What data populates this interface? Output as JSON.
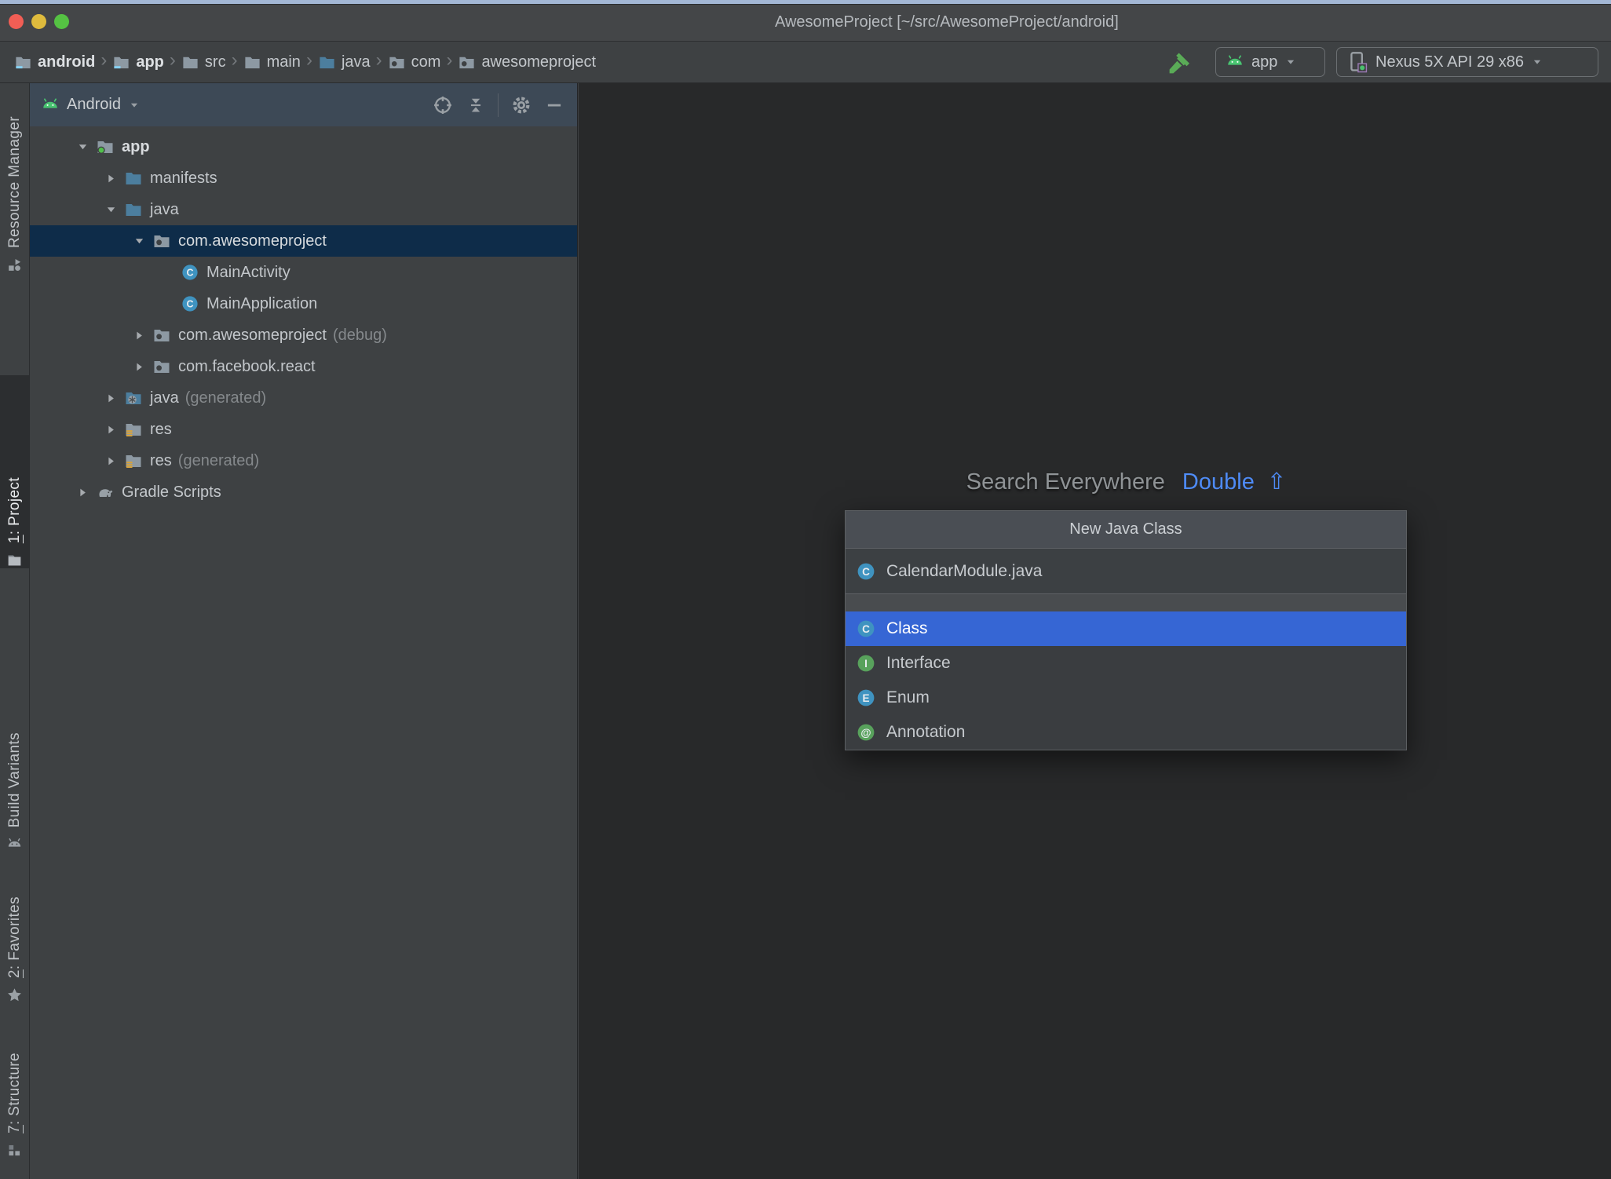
{
  "window": {
    "title": "AwesomeProject [~/src/AwesomeProject/android]"
  },
  "toolbar": {
    "breadcrumbs": [
      {
        "label": "android",
        "icon": "module-folder-icon",
        "bold": true
      },
      {
        "label": "app",
        "icon": "module-folder-icon",
        "bold": true
      },
      {
        "label": "src",
        "icon": "folder-icon",
        "bold": false
      },
      {
        "label": "main",
        "icon": "folder-icon",
        "bold": false
      },
      {
        "label": "java",
        "icon": "source-folder-icon",
        "bold": false
      },
      {
        "label": "com",
        "icon": "package-icon",
        "bold": false
      },
      {
        "label": "awesomeproject",
        "icon": "package-icon",
        "bold": false
      }
    ],
    "run_config": {
      "label": "app"
    },
    "device": {
      "label": "Nexus 5X API 29 x86"
    }
  },
  "sidebar": {
    "top": [
      {
        "label": "Resource Manager",
        "icon": "resource-manager-icon",
        "active": false,
        "mnemonic": false
      },
      {
        "label": "1: Project",
        "icon": "project-icon",
        "active": true,
        "mnemonic": true
      }
    ],
    "bottom": [
      {
        "label": "Build Variants",
        "icon": "build-variants-icon",
        "active": false,
        "mnemonic": false
      },
      {
        "label": "2: Favorites",
        "icon": "favorites-star-icon",
        "active": false,
        "mnemonic": true
      },
      {
        "label": "7: Structure",
        "icon": "structure-icon",
        "active": false,
        "mnemonic": true
      }
    ]
  },
  "project_panel": {
    "view": "Android",
    "tree": [
      {
        "label": "app",
        "annotation": "",
        "icon": "app-module-folder-icon",
        "arrow": "expanded",
        "level": 0,
        "selected": false,
        "bold": true
      },
      {
        "label": "manifests",
        "annotation": "",
        "icon": "source-folder-icon",
        "arrow": "collapsed",
        "level": 1,
        "selected": false,
        "bold": false
      },
      {
        "label": "java",
        "annotation": "",
        "icon": "source-folder-icon",
        "arrow": "expanded",
        "level": 1,
        "selected": false,
        "bold": false
      },
      {
        "label": "com.awesomeproject",
        "annotation": "",
        "icon": "package-icon",
        "arrow": "expanded",
        "level": 2,
        "selected": true,
        "bold": false
      },
      {
        "label": "MainActivity",
        "annotation": "",
        "icon": "class-icon",
        "arrow": "none",
        "level": 3,
        "selected": false,
        "bold": false
      },
      {
        "label": "MainApplication",
        "annotation": "",
        "icon": "class-icon",
        "arrow": "none",
        "level": 3,
        "selected": false,
        "bold": false
      },
      {
        "label": "com.awesomeproject",
        "annotation": "(debug)",
        "icon": "package-icon",
        "arrow": "collapsed",
        "level": 2,
        "selected": false,
        "bold": false
      },
      {
        "label": "com.facebook.react",
        "annotation": "",
        "icon": "package-icon",
        "arrow": "collapsed",
        "level": 2,
        "selected": false,
        "bold": false
      },
      {
        "label": "java",
        "annotation": "(generated)",
        "icon": "generated-java-folder-icon",
        "arrow": "collapsed",
        "level": 1,
        "selected": false,
        "bold": false
      },
      {
        "label": "res",
        "annotation": "",
        "icon": "res-folder-icon",
        "arrow": "collapsed",
        "level": 1,
        "selected": false,
        "bold": false
      },
      {
        "label": "res",
        "annotation": "(generated)",
        "icon": "res-folder-icon",
        "arrow": "collapsed",
        "level": 1,
        "selected": false,
        "bold": false
      },
      {
        "label": "Gradle Scripts",
        "annotation": "",
        "icon": "gradle-icon",
        "arrow": "collapsed",
        "level": 0,
        "selected": false,
        "bold": false
      }
    ]
  },
  "editor": {
    "hint_text": "Search Everywhere",
    "hint_shortcut": "Double",
    "hint_shortcut_symbol": "⇧"
  },
  "popup": {
    "title": "New Java Class",
    "name_value": "CalendarModule.java",
    "kinds": [
      {
        "label": "Class",
        "icon": "class-icon",
        "selected": true
      },
      {
        "label": "Interface",
        "icon": "interface-icon",
        "selected": false
      },
      {
        "label": "Enum",
        "icon": "enum-icon",
        "selected": false
      },
      {
        "label": "Annotation",
        "icon": "annotation-icon",
        "selected": false
      }
    ]
  },
  "colors": {
    "android_green": "#49c471",
    "tree_selection": "#0e2c49",
    "list_selection": "#3666d4",
    "hint_link": "#4f8cf7",
    "panel_header": "#3d4956"
  }
}
